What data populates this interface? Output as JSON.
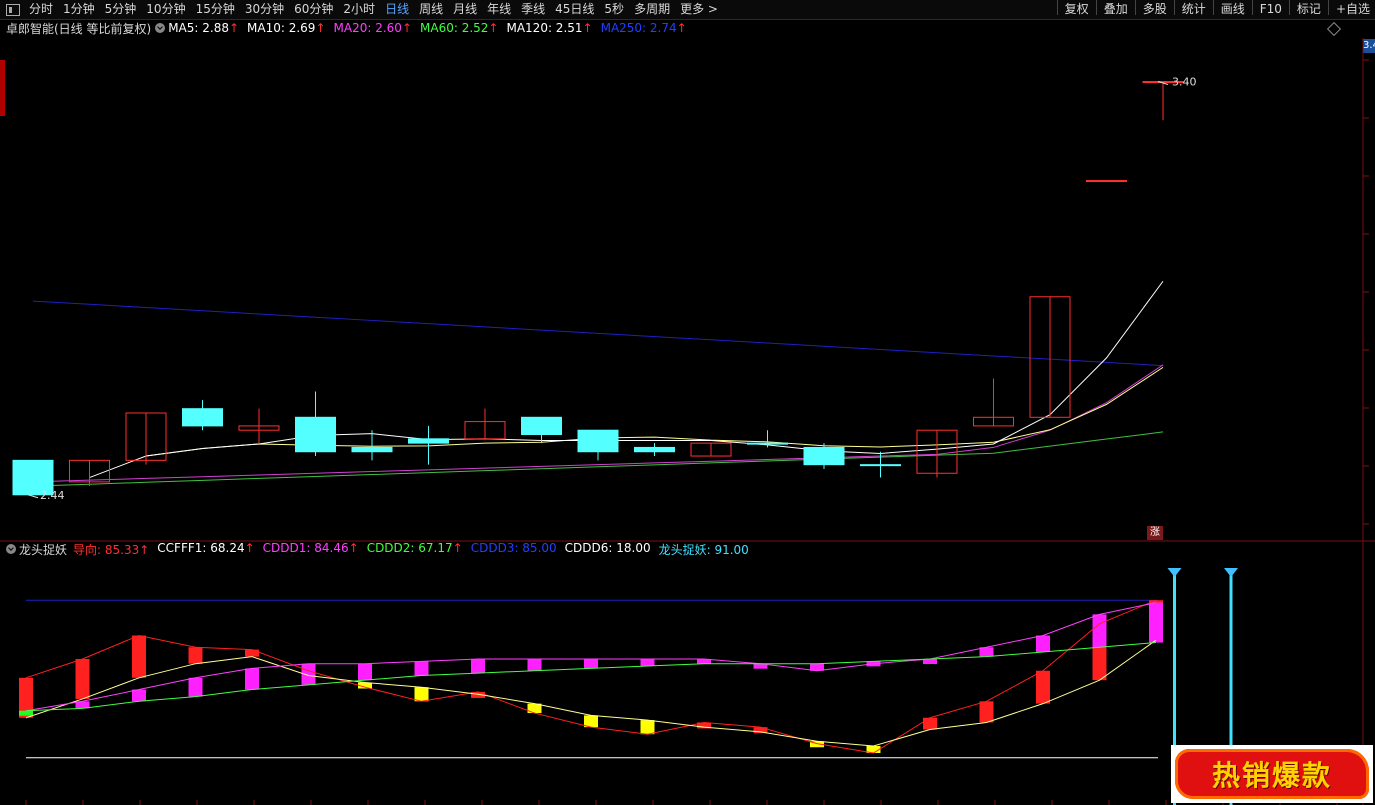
{
  "toolbar": {
    "periods": [
      "分时",
      "1分钟",
      "5分钟",
      "10分钟",
      "15分钟",
      "30分钟",
      "60分钟",
      "2小时",
      "日线",
      "周线",
      "月线",
      "年线",
      "季线",
      "45日线",
      "5秒",
      "多周期",
      "更多 >"
    ],
    "active": "日线",
    "right": [
      "复权",
      "叠加",
      "多股",
      "统计",
      "画线",
      "F10",
      "标记",
      "+自选"
    ]
  },
  "main_legend": {
    "title": "卓郎智能(日线 等比前复权)",
    "items": [
      {
        "label": "MA5: 2.88",
        "color": "#ffffff"
      },
      {
        "label": "MA10: 2.69",
        "color": "#ffffff"
      },
      {
        "label": "MA20: 2.60",
        "color": "#ff40ff"
      },
      {
        "label": "MA60: 2.52",
        "color": "#40ff40"
      },
      {
        "label": "MA120: 2.51",
        "color": "#ffffff"
      },
      {
        "label": "MA250: 2.74",
        "color": "#2040ff"
      }
    ]
  },
  "sub_legend": {
    "title": "龙头捉妖",
    "items": [
      {
        "label": "导向: 85.33",
        "color": "#ff3030",
        "arrow": true
      },
      {
        "label": "CCFFF1: 68.24",
        "color": "#ffffff",
        "arrow": true
      },
      {
        "label": "CDDD1: 84.46",
        "color": "#ff40ff",
        "arrow": true
      },
      {
        "label": "CDDD2: 67.17",
        "color": "#40ff40",
        "arrow": true
      },
      {
        "label": "CDDD3: 85.00",
        "color": "#2040ff",
        "arrow": false
      },
      {
        "label": "CDDD6: 18.00",
        "color": "#ffffff",
        "arrow": false
      },
      {
        "label": "龙头捉妖: 91.00",
        "color": "#40e0ff",
        "arrow": false
      }
    ]
  },
  "price_labels": {
    "high": "3.40",
    "low": "2.44"
  },
  "zhang_label": "涨",
  "right_tag": "3.4",
  "badge_text": "热销爆款",
  "colors": {
    "up": "#ff3030",
    "down": "#54ffff",
    "ma250": "#2020c0",
    "ma20": "#d040d0",
    "ma60": "#40c040",
    "ma5": "#ffffff",
    "ma10": "#ffff90",
    "arrow": "#ff3030"
  },
  "chart_data": [
    {
      "type": "candlestick",
      "title": "卓郎智能(日线 等比前复权)",
      "candles": [
        {
          "o": 2.52,
          "c": 2.44,
          "h": 2.52,
          "l": 2.44,
          "dir": "down"
        },
        {
          "o": 2.47,
          "c": 2.52,
          "h": 2.52,
          "l": 2.46,
          "dir": "up"
        },
        {
          "o": 2.52,
          "c": 2.63,
          "h": 2.63,
          "l": 2.51,
          "dir": "up"
        },
        {
          "o": 2.64,
          "c": 2.6,
          "h": 2.66,
          "l": 2.59,
          "dir": "down"
        },
        {
          "o": 2.59,
          "c": 2.6,
          "h": 2.64,
          "l": 2.56,
          "dir": "up"
        },
        {
          "o": 2.62,
          "c": 2.54,
          "h": 2.68,
          "l": 2.53,
          "dir": "down"
        },
        {
          "o": 2.55,
          "c": 2.54,
          "h": 2.59,
          "l": 2.52,
          "dir": "down"
        },
        {
          "o": 2.57,
          "c": 2.56,
          "h": 2.6,
          "l": 2.51,
          "dir": "down"
        },
        {
          "o": 2.57,
          "c": 2.61,
          "h": 2.64,
          "l": 2.57,
          "dir": "up"
        },
        {
          "o": 2.62,
          "c": 2.58,
          "h": 2.62,
          "l": 2.56,
          "dir": "down"
        },
        {
          "o": 2.59,
          "c": 2.54,
          "h": 2.59,
          "l": 2.52,
          "dir": "down"
        },
        {
          "o": 2.55,
          "c": 2.54,
          "h": 2.56,
          "l": 2.53,
          "dir": "down"
        },
        {
          "o": 2.53,
          "c": 2.56,
          "h": 2.56,
          "l": 2.53,
          "dir": "up"
        },
        {
          "o": 2.56,
          "c": 2.56,
          "h": 2.59,
          "l": 2.55,
          "dir": "down"
        },
        {
          "o": 2.55,
          "c": 2.51,
          "h": 2.56,
          "l": 2.5,
          "dir": "down"
        },
        {
          "o": 2.51,
          "c": 2.51,
          "h": 2.54,
          "l": 2.48,
          "dir": "down"
        },
        {
          "o": 2.49,
          "c": 2.59,
          "h": 2.59,
          "l": 2.48,
          "dir": "up"
        },
        {
          "o": 2.6,
          "c": 2.62,
          "h": 2.71,
          "l": 2.6,
          "dir": "up"
        },
        {
          "o": 2.62,
          "c": 2.9,
          "h": 2.9,
          "l": 2.62,
          "dir": "up"
        },
        {
          "o": 3.17,
          "c": 3.17,
          "h": 3.17,
          "l": 3.17,
          "dir": "up"
        },
        {
          "o": 3.4,
          "c": 3.4,
          "h": 3.4,
          "l": 3.31,
          "dir": "up"
        }
      ],
      "ylim": [
        2.4,
        3.45
      ]
    },
    {
      "type": "bar",
      "title": "龙头捉妖",
      "ylim": [
        0,
        100
      ],
      "reference_lines": {
        "CDDD3": 85.0,
        "CDDD6": 18.0
      },
      "series": [
        {
          "name": "导向",
          "values": [
            52,
            60,
            70,
            65,
            64,
            55,
            48,
            42,
            46,
            37,
            31,
            28,
            33,
            31,
            24,
            20,
            35,
            42,
            55,
            75,
            85
          ]
        },
        {
          "name": "CCFFF1",
          "values": [
            35,
            43,
            52,
            58,
            61,
            53,
            50,
            48,
            45,
            41,
            36,
            34,
            31,
            29,
            25,
            23,
            30,
            33,
            41,
            51,
            68
          ]
        },
        {
          "name": "CDDD1",
          "values": [
            38,
            42,
            47,
            52,
            56,
            58,
            58,
            59,
            60,
            60,
            60,
            60,
            60,
            58,
            55,
            58,
            60,
            65,
            70,
            79,
            84
          ]
        },
        {
          "name": "CDDD2",
          "values": [
            38,
            39,
            42,
            44,
            47,
            49,
            51,
            53,
            54,
            55,
            56,
            57,
            58,
            58,
            58,
            59,
            60,
            61,
            63,
            65,
            67
          ]
        }
      ],
      "signal": {
        "name": "龙头捉妖",
        "values": [
          0,
          0,
          0,
          0,
          0,
          0,
          0,
          0,
          0,
          0,
          0,
          0,
          0,
          0,
          0,
          0,
          0,
          0,
          0,
          91,
          91
        ]
      }
    }
  ]
}
